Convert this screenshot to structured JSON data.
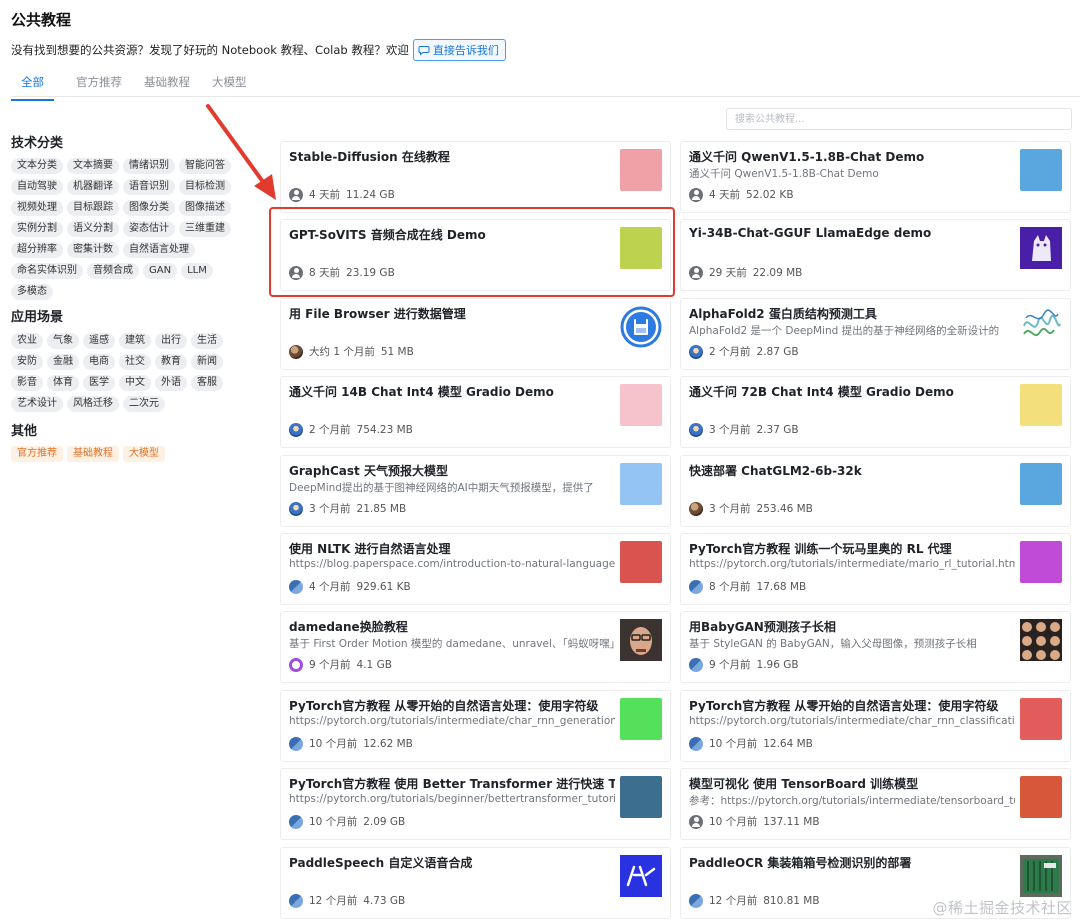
{
  "page": {
    "title": "公共教程",
    "intro": "没有找到想要的公共资源？发现了好玩的 Notebook 教程、Colab 教程？欢迎",
    "feedback_label": "直接告诉我们"
  },
  "tabs": [
    "全部",
    "官方推荐",
    "基础教程",
    "大模型"
  ],
  "search": {
    "placeholder": "搜索公共教程..."
  },
  "sidebar": {
    "tech_title": "技术分类",
    "tech_tags": [
      "文本分类",
      "文本摘要",
      "情绪识别",
      "智能问答",
      "自动驾驶",
      "机器翻译",
      "语音识别",
      "目标检测",
      "视频处理",
      "目标跟踪",
      "图像分类",
      "图像描述",
      "实例分割",
      "语义分割",
      "姿态估计",
      "三维重建",
      "超分辨率",
      "密集计数",
      "自然语言处理",
      "命名实体识别",
      "音频合成",
      "GAN",
      "LLM",
      "多模态"
    ],
    "scene_title": "应用场景",
    "scene_tags": [
      "农业",
      "气象",
      "遥感",
      "建筑",
      "出行",
      "生活",
      "安防",
      "金融",
      "电商",
      "社交",
      "教育",
      "新闻",
      "影音",
      "体育",
      "医学",
      "中文",
      "外语",
      "客服",
      "艺术设计",
      "风格迁移",
      "二次元"
    ],
    "other_title": "其他",
    "other_tags": [
      "官方推荐",
      "基础教程",
      "大模型"
    ]
  },
  "colors": {
    "accent": "#1677d8",
    "highlight": "#e23b2e",
    "orange": "#e3712a"
  },
  "cards": [
    {
      "title": "Stable-Diffusion 在线教程",
      "desc": "",
      "time": "4 天前",
      "size": "11.24 GB",
      "avatar": "gray",
      "thumb": "#f0a1a8"
    },
    {
      "title": "通义千问 QwenV1.5-1.8B-Chat Demo",
      "desc": "通义千问 QwenV1.5-1.8B-Chat Demo",
      "time": "4 天前",
      "size": "52.02 KB",
      "avatar": "gray",
      "thumb": "#5aa6df"
    },
    {
      "title": "GPT-SoVITS 音频合成在线 Demo",
      "desc": "",
      "time": "8 天前",
      "size": "23.19 GB",
      "avatar": "gray",
      "thumb": "#bdd350"
    },
    {
      "title": "Yi-34B-Chat-GGUF LlamaEdge demo",
      "desc": "",
      "time": "29 天前",
      "size": "22.09 MB",
      "avatar": "gray",
      "thumb": "llama-logo"
    },
    {
      "title": "用 File Browser 进行数据管理",
      "desc": "",
      "time": "大约 1 个月前",
      "size": "51 MB",
      "avatar": "photo",
      "thumb": "save-logo"
    },
    {
      "title": "AlphaFold2 蛋白质结构预测工具",
      "desc": "AlphaFold2 是一个 DeepMind 提出的基于神经网络的全新设计的",
      "time": "2 个月前",
      "size": "2.87 GB",
      "avatar": "blue",
      "thumb": "protein"
    },
    {
      "title": "通义千问 14B Chat Int4 模型 Gradio Demo",
      "desc": "",
      "time": "2 个月前",
      "size": "754.23 MB",
      "avatar": "blue",
      "thumb": "#f6c3cc"
    },
    {
      "title": "通义千问 72B Chat Int4 模型 Gradio Demo",
      "desc": "",
      "time": "3 个月前",
      "size": "2.37 GB",
      "avatar": "blue",
      "thumb": "#f3df7c"
    },
    {
      "title": "GraphCast 天气预报大模型",
      "desc": "DeepMind提出的基于图神经网络的AI中期天气预报模型，提供了",
      "time": "3 个月前",
      "size": "21.85 MB",
      "avatar": "blue",
      "thumb": "#93c4f3"
    },
    {
      "title": "快速部署 ChatGLM2-6b-32k",
      "desc": "",
      "time": "3 个月前",
      "size": "253.46 MB",
      "avatar": "photo",
      "thumb": "#5aa6df"
    },
    {
      "title": "使用 NLTK 进行自然语言处理",
      "desc": "https://blog.paperspace.com/introduction-to-natural-language-",
      "time": "4 个月前",
      "size": "929.61 KB",
      "avatar": "grid",
      "thumb": "#d9534f"
    },
    {
      "title": "PyTorch官方教程 训练一个玩马里奥的 RL 代理",
      "desc": "https://pytorch.org/tutorials/intermediate/mario_rl_tutorial.html",
      "time": "8 个月前",
      "size": "17.68 MB",
      "avatar": "grid",
      "thumb": "#c04bd6"
    },
    {
      "title": "damedane换脸教程",
      "desc": "基于 First Order Motion 模型的 damedane、unravel、「蚂蚁呀嘿」",
      "time": "9 个月前",
      "size": "4.1 GB",
      "avatar": "purple",
      "thumb": "face"
    },
    {
      "title": "用BabyGAN预测孩子长相",
      "desc": "基于 StyleGAN 的 BabyGAN，输入父母图像，预测孩子长相",
      "time": "9 个月前",
      "size": "1.96 GB",
      "avatar": "grid",
      "thumb": "faces"
    },
    {
      "title": "PyTorch官方教程 从零开始的自然语言处理：使用字符级",
      "desc": "https://pytorch.org/tutorials/intermediate/char_rnn_generation",
      "time": "10 个月前",
      "size": "12.62 MB",
      "avatar": "grid",
      "thumb": "#54e05b"
    },
    {
      "title": "PyTorch官方教程 从零开始的自然语言处理：使用字符级",
      "desc": "https://pytorch.org/tutorials/intermediate/char_rnn_classification",
      "time": "10 个月前",
      "size": "12.64 MB",
      "avatar": "grid",
      "thumb": "#e25c5c"
    },
    {
      "title": "PyTorch官方教程 使用 Better Transformer 进行快速 Transformer",
      "desc": "https://pytorch.org/tutorials/beginner/bettertransformer_tutorial",
      "time": "10 个月前",
      "size": "2.09 GB",
      "avatar": "grid",
      "thumb": "#3c6f8f"
    },
    {
      "title": "模型可视化 使用 TensorBoard 训练模型",
      "desc": "参考：https://pytorch.org/tutorials/intermediate/tensorboard_tut",
      "time": "10 个月前",
      "size": "137.11 MB",
      "avatar": "gray",
      "thumb": "#d6573a"
    },
    {
      "title": "PaddleSpeech 自定义语音合成",
      "desc": "",
      "time": "12 个月前",
      "size": "4.73 GB",
      "avatar": "grid",
      "thumb": "paddle-logo"
    },
    {
      "title": "PaddleOCR 集装箱箱号检测识别的部署",
      "desc": "",
      "time": "12 个月前",
      "size": "810.81 MB",
      "avatar": "grid",
      "thumb": "container"
    }
  ],
  "watermark": "@稀土掘金技术社区"
}
